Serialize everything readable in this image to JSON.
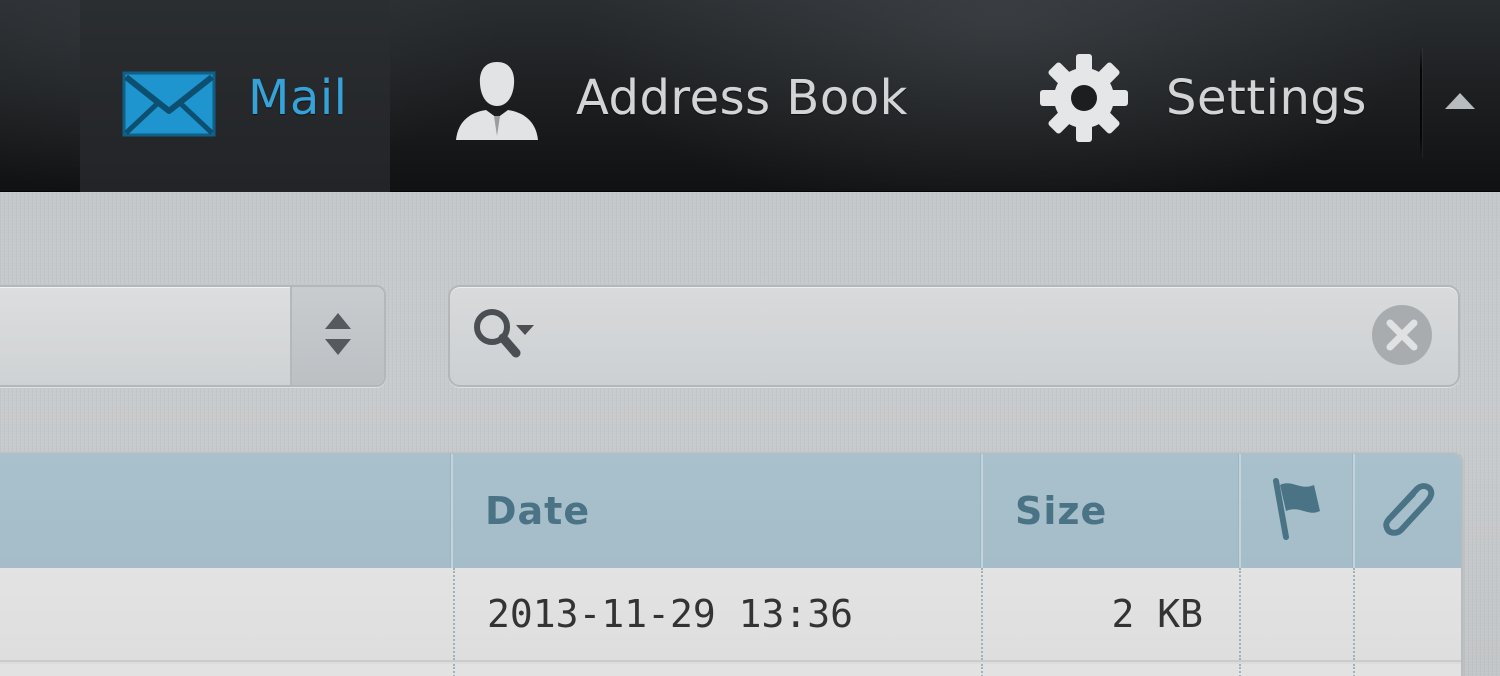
{
  "nav": {
    "items": [
      {
        "label": "Mail",
        "icon": "envelope-icon",
        "selected": true
      },
      {
        "label": "Address Book",
        "icon": "person-icon",
        "selected": false
      },
      {
        "label": "Settings",
        "icon": "gear-icon",
        "selected": false
      }
    ],
    "collapse_icon": "triangle-up-icon"
  },
  "toolbar": {
    "folder_select": {
      "value": "",
      "icon": "updown-arrows-icon"
    },
    "search": {
      "value": "",
      "placeholder": "",
      "menu_icon": "magnifier-dropdown-icon",
      "reset_icon": "close-circle-icon"
    }
  },
  "messagelist": {
    "columns": [
      {
        "key": "subject",
        "label": ""
      },
      {
        "key": "date",
        "label": "Date"
      },
      {
        "key": "size",
        "label": "Size"
      },
      {
        "key": "flag",
        "label": "",
        "icon": "flag-icon"
      },
      {
        "key": "attachment",
        "label": "",
        "icon": "paperclip-icon"
      }
    ],
    "rows": [
      {
        "subject": "",
        "date": "2013-11-29 13:36",
        "size": "2 KB",
        "flagged": false,
        "attachment": false
      }
    ]
  },
  "colors": {
    "accent": "#36a2d8",
    "nav_text": "#d2d4d6",
    "header_bg": "#a9c1cc",
    "header_text": "#4a7386"
  }
}
